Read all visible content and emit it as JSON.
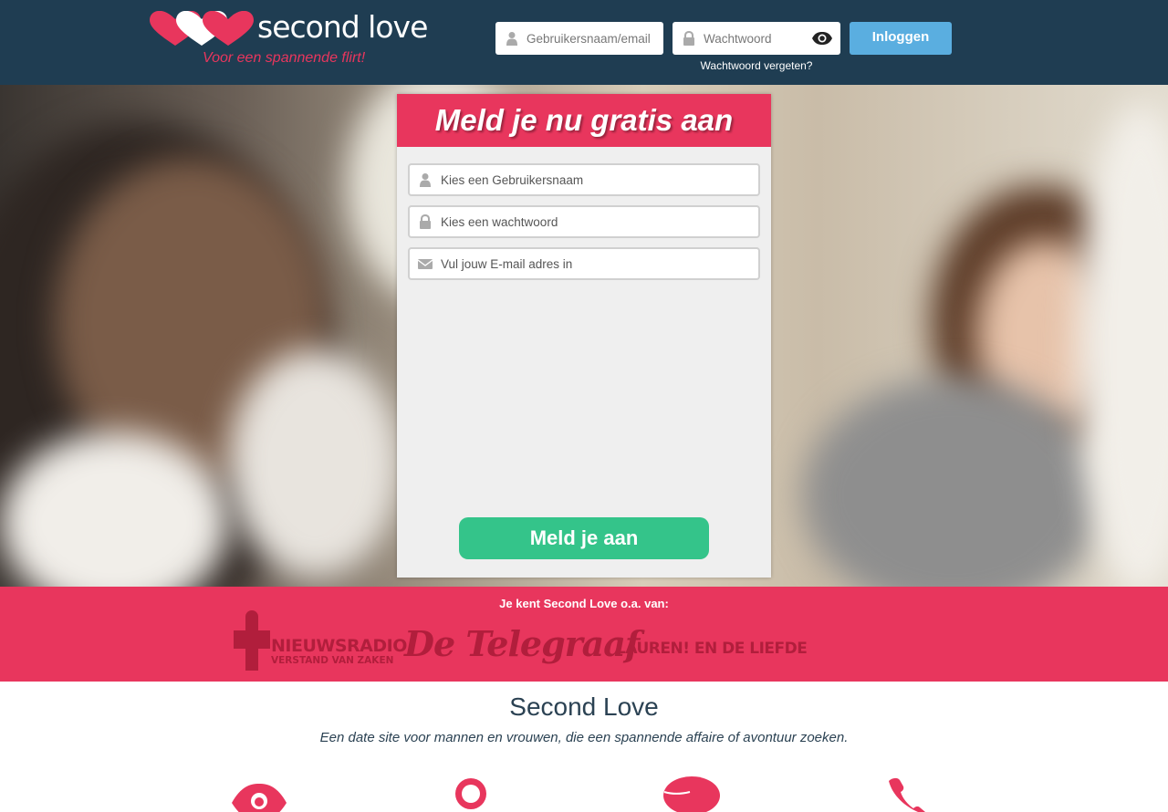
{
  "header": {
    "logo_text": "second love",
    "tagline": "Voor een spannende flirt!",
    "username_placeholder": "Gebruikersnaam/email",
    "password_placeholder": "Wachtwoord",
    "login_label": "Inloggen",
    "forgot_label": "Wachtwoord vergeten?"
  },
  "signup": {
    "title": "Meld je nu gratis aan",
    "username_placeholder": "Kies een Gebruikersnaam",
    "password_placeholder": "Kies een wachtwoord",
    "email_placeholder": "Vul jouw E-mail adres in",
    "submit_label": "Meld je aan"
  },
  "press": {
    "title": "Je kent Second Love o.a. van:",
    "logos": [
      {
        "line1": "NIEUWSRADIO",
        "line2": "VERSTAND VAN ZAKEN"
      },
      {
        "name": "De Telegraaf"
      },
      {
        "name": "LAUREN! EN DE LIEFDE"
      }
    ]
  },
  "intro": {
    "title": "Second Love",
    "subtitle": "Een date site voor mannen en vrouwen, die een spannende affaire of avontuur zoeken."
  },
  "features": [
    {
      "icon": "eye-icon"
    },
    {
      "icon": "search-icon"
    },
    {
      "icon": "chat-icon"
    },
    {
      "icon": "phone-icon"
    }
  ],
  "colors": {
    "brand_pink": "#e8365d",
    "header_navy": "#1f3d52",
    "login_blue": "#5aaee0",
    "signup_green": "#34c48a"
  }
}
